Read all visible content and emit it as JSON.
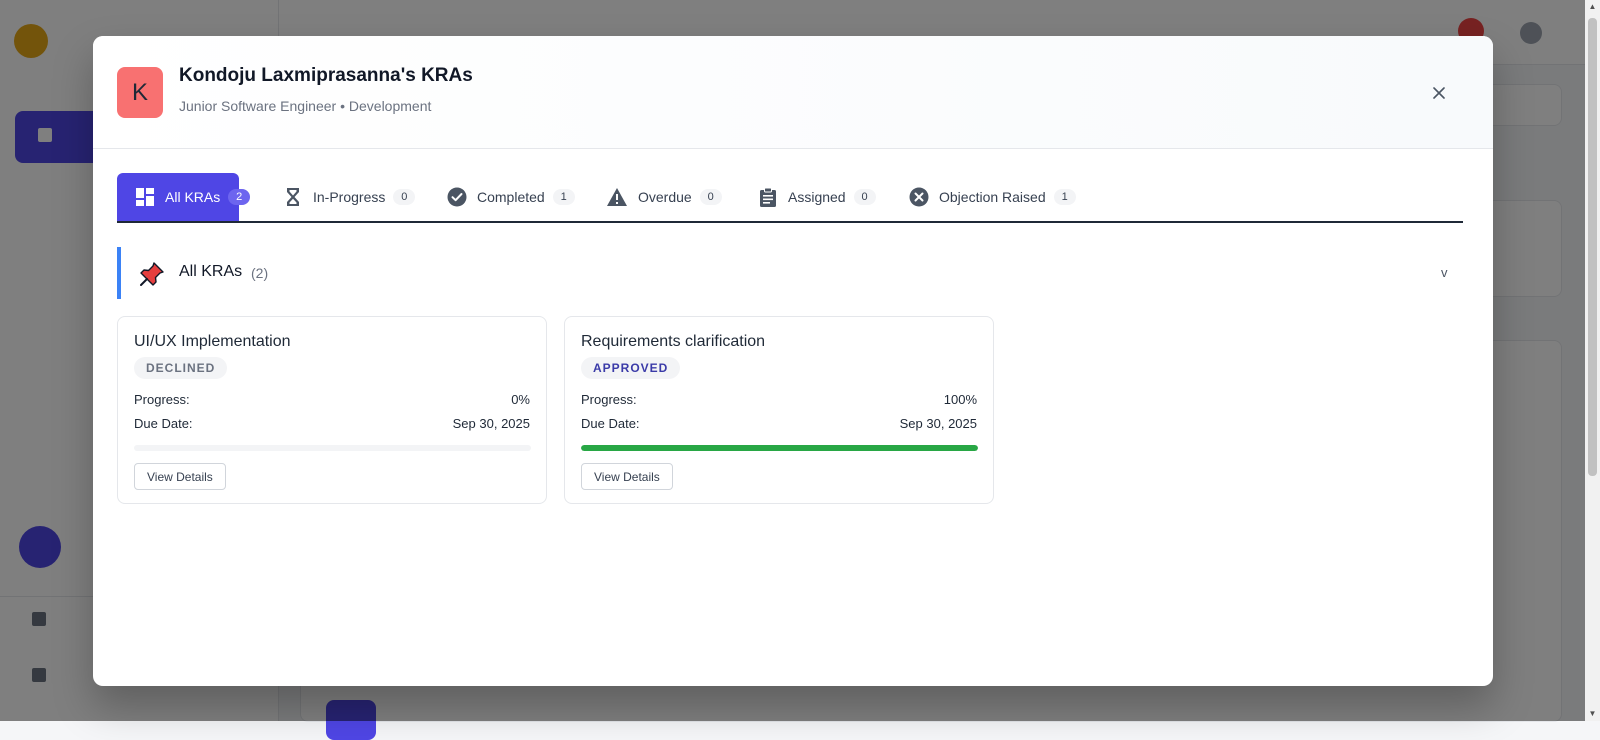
{
  "modal": {
    "avatar_letter": "K",
    "title": "Kondoju Laxmiprasanna's KRAs",
    "subtitle": "Junior Software Engineer • Development",
    "close_icon": "×"
  },
  "tabs": [
    {
      "label": "All KRAs",
      "count": "2",
      "icon": "dashboard-icon",
      "active": true
    },
    {
      "label": "In-Progress",
      "count": "0",
      "icon": "hourglass-icon",
      "active": false
    },
    {
      "label": "Completed",
      "count": "1",
      "icon": "check-circle-icon",
      "active": false
    },
    {
      "label": "Overdue",
      "count": "0",
      "icon": "warning-icon",
      "active": false
    },
    {
      "label": "Assigned",
      "count": "0",
      "icon": "clipboard-icon",
      "active": false
    },
    {
      "label": "Objection Raised",
      "count": "1",
      "icon": "x-circle-icon",
      "active": false
    }
  ],
  "section": {
    "icon": "pushpin-icon",
    "title": "All KRAs",
    "count": "(2)",
    "chevron": "v"
  },
  "kras": [
    {
      "title": "UI/UX Implementation",
      "status": "DECLINED",
      "status_color": "#6b7280",
      "progress_label": "Progress:",
      "progress_value": "0%",
      "progress_fraction": 0,
      "due_label": "Due Date:",
      "due_value": "Sep 30, 2025",
      "button": "View Details"
    },
    {
      "title": "Requirements clarification",
      "status": "APPROVED",
      "status_color": "#3b3ba8",
      "progress_label": "Progress:",
      "progress_value": "100%",
      "progress_fraction": 1,
      "due_label": "Due Date:",
      "due_value": "Sep 30, 2025",
      "button": "View Details"
    }
  ],
  "colors": {
    "accent": "#4f46e5",
    "avatar_bg": "#f87171",
    "section_border": "#3b82f6",
    "progress_fill": "#28a745"
  }
}
